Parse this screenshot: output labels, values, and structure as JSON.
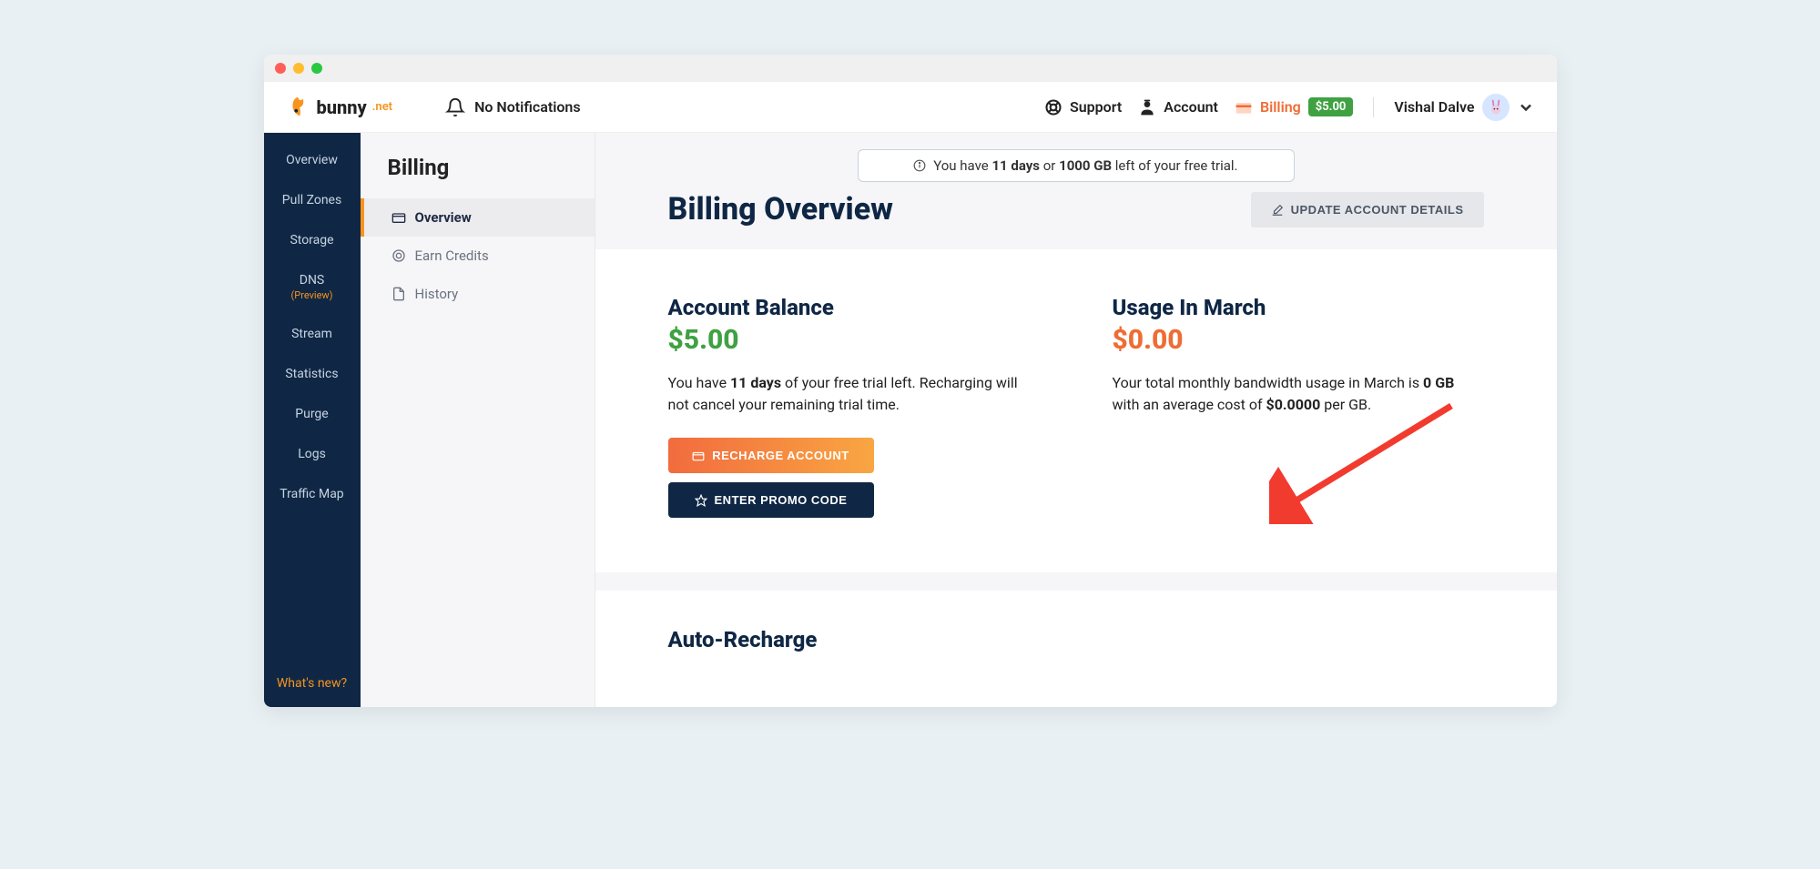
{
  "topbar": {
    "logo_text": "bunny",
    "logo_suffix": ".net",
    "notifications": "No Notifications",
    "support": "Support",
    "account": "Account",
    "billing": "Billing",
    "balance_badge": "$5.00",
    "user_name": "Vishal Dalve"
  },
  "sidenav": {
    "items": [
      "Overview",
      "Pull Zones",
      "Storage",
      "DNS",
      "Stream",
      "Statistics",
      "Purge",
      "Logs",
      "Traffic Map"
    ],
    "dns_sub": "(Preview)",
    "footer": "What's new?"
  },
  "subnav": {
    "title": "Billing",
    "items": [
      {
        "label": "Overview"
      },
      {
        "label": "Earn Credits"
      },
      {
        "label": "History"
      }
    ]
  },
  "trial": {
    "prefix": "You have ",
    "days": "11 days",
    "mid": " or ",
    "gb": "1000 GB",
    "suffix": " left of your free trial."
  },
  "main": {
    "title": "Billing Overview",
    "update_btn": "UPDATE ACCOUNT DETAILS",
    "balance": {
      "heading": "Account Balance",
      "amount": "$5.00",
      "desc_pre": "You have ",
      "desc_days": "11 days",
      "desc_post": " of your free trial left. Recharging will not cancel your remaining trial time.",
      "recharge_btn": "RECHARGE ACCOUNT",
      "promo_btn": "ENTER PROMO CODE"
    },
    "usage": {
      "heading": "Usage In March",
      "amount": "$0.00",
      "desc_pre": "Your total monthly bandwidth usage in March is ",
      "desc_gb": "0 GB",
      "desc_mid": " with an average cost of ",
      "desc_cost": "$0.0000",
      "desc_post": " per GB."
    },
    "auto_recharge_heading": "Auto-Recharge"
  }
}
